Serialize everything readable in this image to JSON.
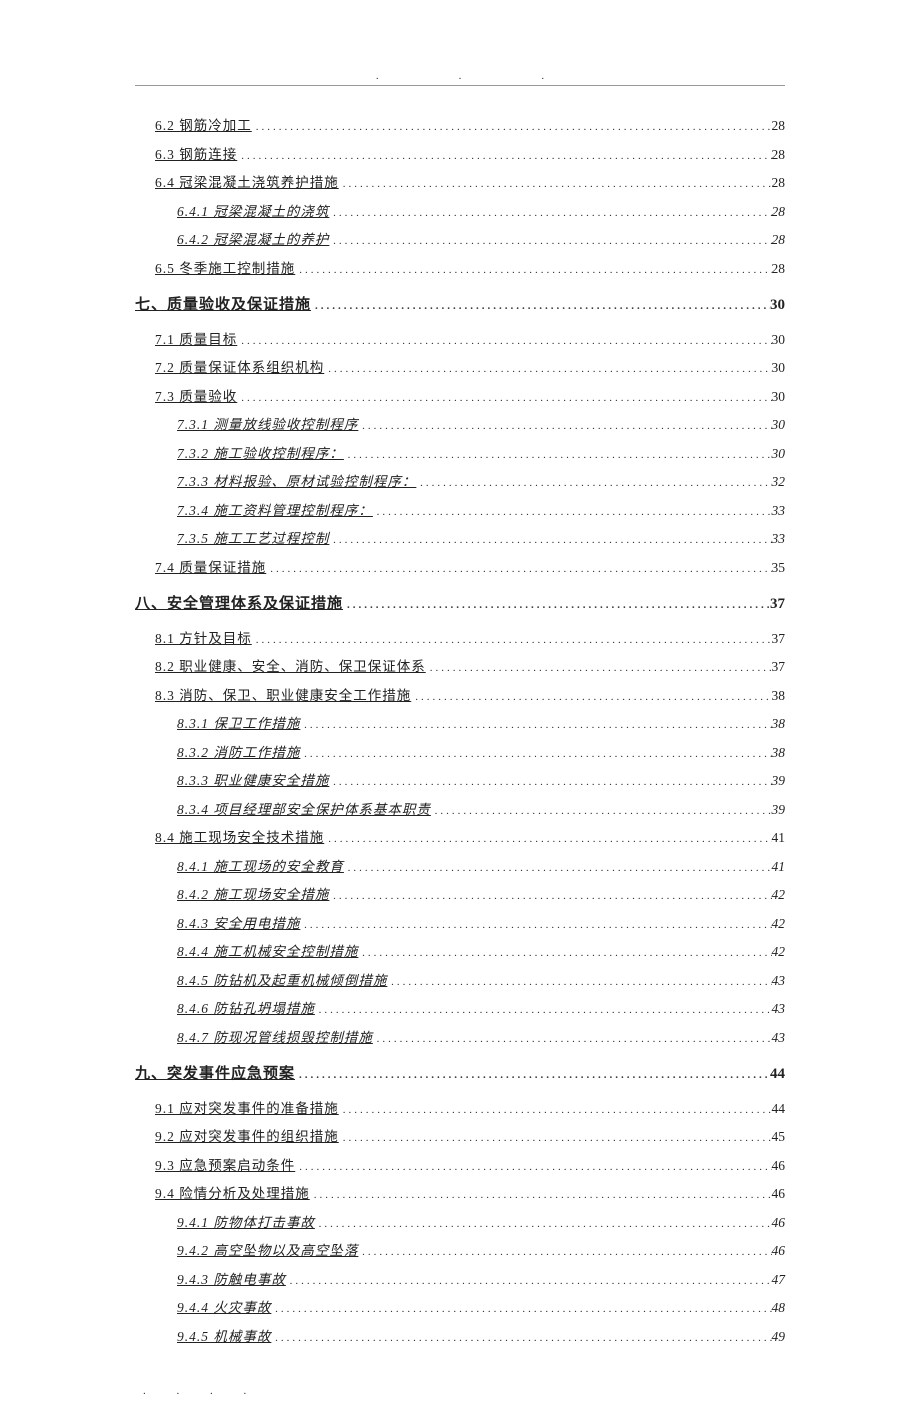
{
  "toc": [
    {
      "level": "h2",
      "title": "6.2 钢筋冷加工",
      "page": "28"
    },
    {
      "level": "h2",
      "title": "6.3 钢筋连接",
      "page": "28"
    },
    {
      "level": "h2",
      "title": "6.4 冠梁混凝土浇筑养护措施",
      "page": "28"
    },
    {
      "level": "h3",
      "title": "6.4.1 冠梁混凝土的浇筑",
      "page": "28"
    },
    {
      "level": "h3",
      "title": "6.4.2 冠梁混凝土的养护",
      "page": "28"
    },
    {
      "level": "h2",
      "title": "6.5 冬季施工控制措施",
      "page": "28"
    },
    {
      "level": "h1",
      "title": "七、质量验收及保证措施",
      "page": "30"
    },
    {
      "level": "h2",
      "title": "7.1 质量目标",
      "page": "30"
    },
    {
      "level": "h2",
      "title": "7.2 质量保证体系组织机构",
      "page": "30"
    },
    {
      "level": "h2",
      "title": "7.3 质量验收",
      "page": "30"
    },
    {
      "level": "h3",
      "title": "7.3.1 测量放线验收控制程序",
      "page": "30"
    },
    {
      "level": "h3",
      "title": "7.3.2 施工验收控制程序：",
      "page": "30"
    },
    {
      "level": "h3",
      "title": "7.3.3 材料报验、原材试验控制程序：",
      "page": "32"
    },
    {
      "level": "h3",
      "title": "7.3.4 施工资料管理控制程序：",
      "page": "33"
    },
    {
      "level": "h3",
      "title": "7.3.5 施工工艺过程控制",
      "page": "33"
    },
    {
      "level": "h2",
      "title": "7.4 质量保证措施",
      "page": "35"
    },
    {
      "level": "h1",
      "title": "八、安全管理体系及保证措施",
      "page": "37"
    },
    {
      "level": "h2",
      "title": "8.1 方针及目标",
      "page": "37"
    },
    {
      "level": "h2",
      "title": "8.2 职业健康、安全、消防、保卫保证体系",
      "page": "37"
    },
    {
      "level": "h2",
      "title": "8.3 消防、保卫、职业健康安全工作措施",
      "page": "38"
    },
    {
      "level": "h3",
      "title": "8.3.1 保卫工作措施",
      "page": "38"
    },
    {
      "level": "h3",
      "title": "8.3.2 消防工作措施",
      "page": "38"
    },
    {
      "level": "h3",
      "title": "8.3.3 职业健康安全措施",
      "page": "39"
    },
    {
      "level": "h3",
      "title": "8.3.4 项目经理部安全保护体系基本职责",
      "page": "39"
    },
    {
      "level": "h2",
      "title": "8.4 施工现场安全技术措施",
      "page": "41"
    },
    {
      "level": "h3",
      "title": "8.4.1 施工现场的安全教育",
      "page": "41"
    },
    {
      "level": "h3",
      "title": "8.4.2 施工现场安全措施",
      "page": "42"
    },
    {
      "level": "h3",
      "title": "8.4.3 安全用电措施",
      "page": "42"
    },
    {
      "level": "h3",
      "title": "8.4.4 施工机械安全控制措施",
      "page": "42"
    },
    {
      "level": "h3",
      "title": "8.4.5 防钻机及起重机械倾倒措施",
      "page": "43"
    },
    {
      "level": "h3",
      "title": "8.4.6 防钻孔坍塌措施",
      "page": "43"
    },
    {
      "level": "h3",
      "title": "8.4.7 防现况管线损毁控制措施",
      "page": "43"
    },
    {
      "level": "h1",
      "title": "九、突发事件应急预案",
      "page": "44"
    },
    {
      "level": "h2",
      "title": "9.1 应对突发事件的准备措施",
      "page": "44"
    },
    {
      "level": "h2",
      "title": "9.2 应对突发事件的组织措施",
      "page": "45"
    },
    {
      "level": "h2",
      "title": "9.3 应急预案启动条件",
      "page": "46"
    },
    {
      "level": "h2",
      "title": "9.4 险情分析及处理措施",
      "page": "46"
    },
    {
      "level": "h3",
      "title": "9.4.1 防物体打击事故",
      "page": "46"
    },
    {
      "level": "h3",
      "title": "9.4.2 高空坠物以及高空坠落",
      "page": "46"
    },
    {
      "level": "h3",
      "title": "9.4.3 防触电事故",
      "page": "47"
    },
    {
      "level": "h3",
      "title": "9.4.4 火灾事故",
      "page": "48"
    },
    {
      "level": "h3",
      "title": "9.4.5 机械事故",
      "page": "49"
    }
  ],
  "header_dots": "...",
  "footer_dots": ". . . ."
}
